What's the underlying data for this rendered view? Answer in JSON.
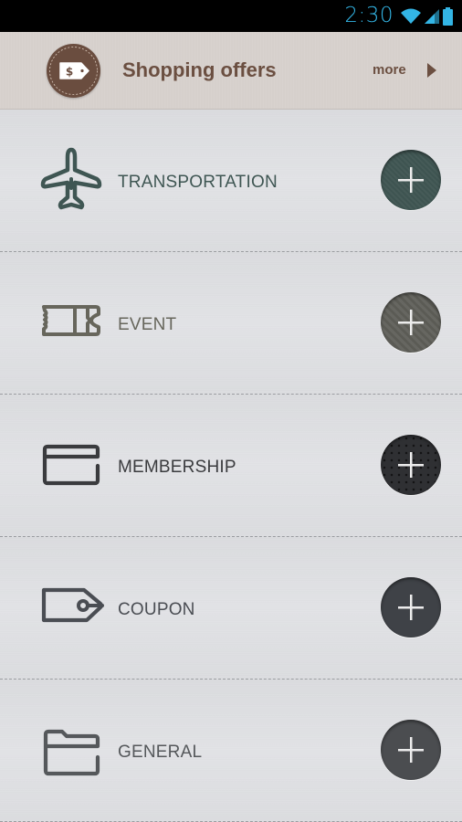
{
  "status_bar": {
    "time": "2:30",
    "icons": [
      "wifi-icon",
      "signal-icon",
      "battery-icon"
    ],
    "accent_color": "#33b5e5"
  },
  "offers": {
    "badge_icon": "price-tag-icon",
    "badge_symbol": "$",
    "title": "Shopping offers",
    "more_label": "more",
    "arrow_icon": "chevron-right-icon",
    "color": "#6b4f41"
  },
  "categories": [
    {
      "label": "TRANSPORTATION",
      "icon": "airplane-icon",
      "color": "#3f5653",
      "add_label": "+"
    },
    {
      "label": "EVENT",
      "icon": "ticket-icon",
      "color": "#67665c",
      "add_label": "+"
    },
    {
      "label": "MEMBERSHIP",
      "icon": "card-icon",
      "color": "#3a3b3e",
      "add_label": "+"
    },
    {
      "label": "COUPON",
      "icon": "coupon-tag-icon",
      "color": "#4a4d53",
      "add_label": "+"
    },
    {
      "label": "GENERAL",
      "icon": "folder-icon",
      "color": "#55585b",
      "add_label": "+"
    }
  ]
}
